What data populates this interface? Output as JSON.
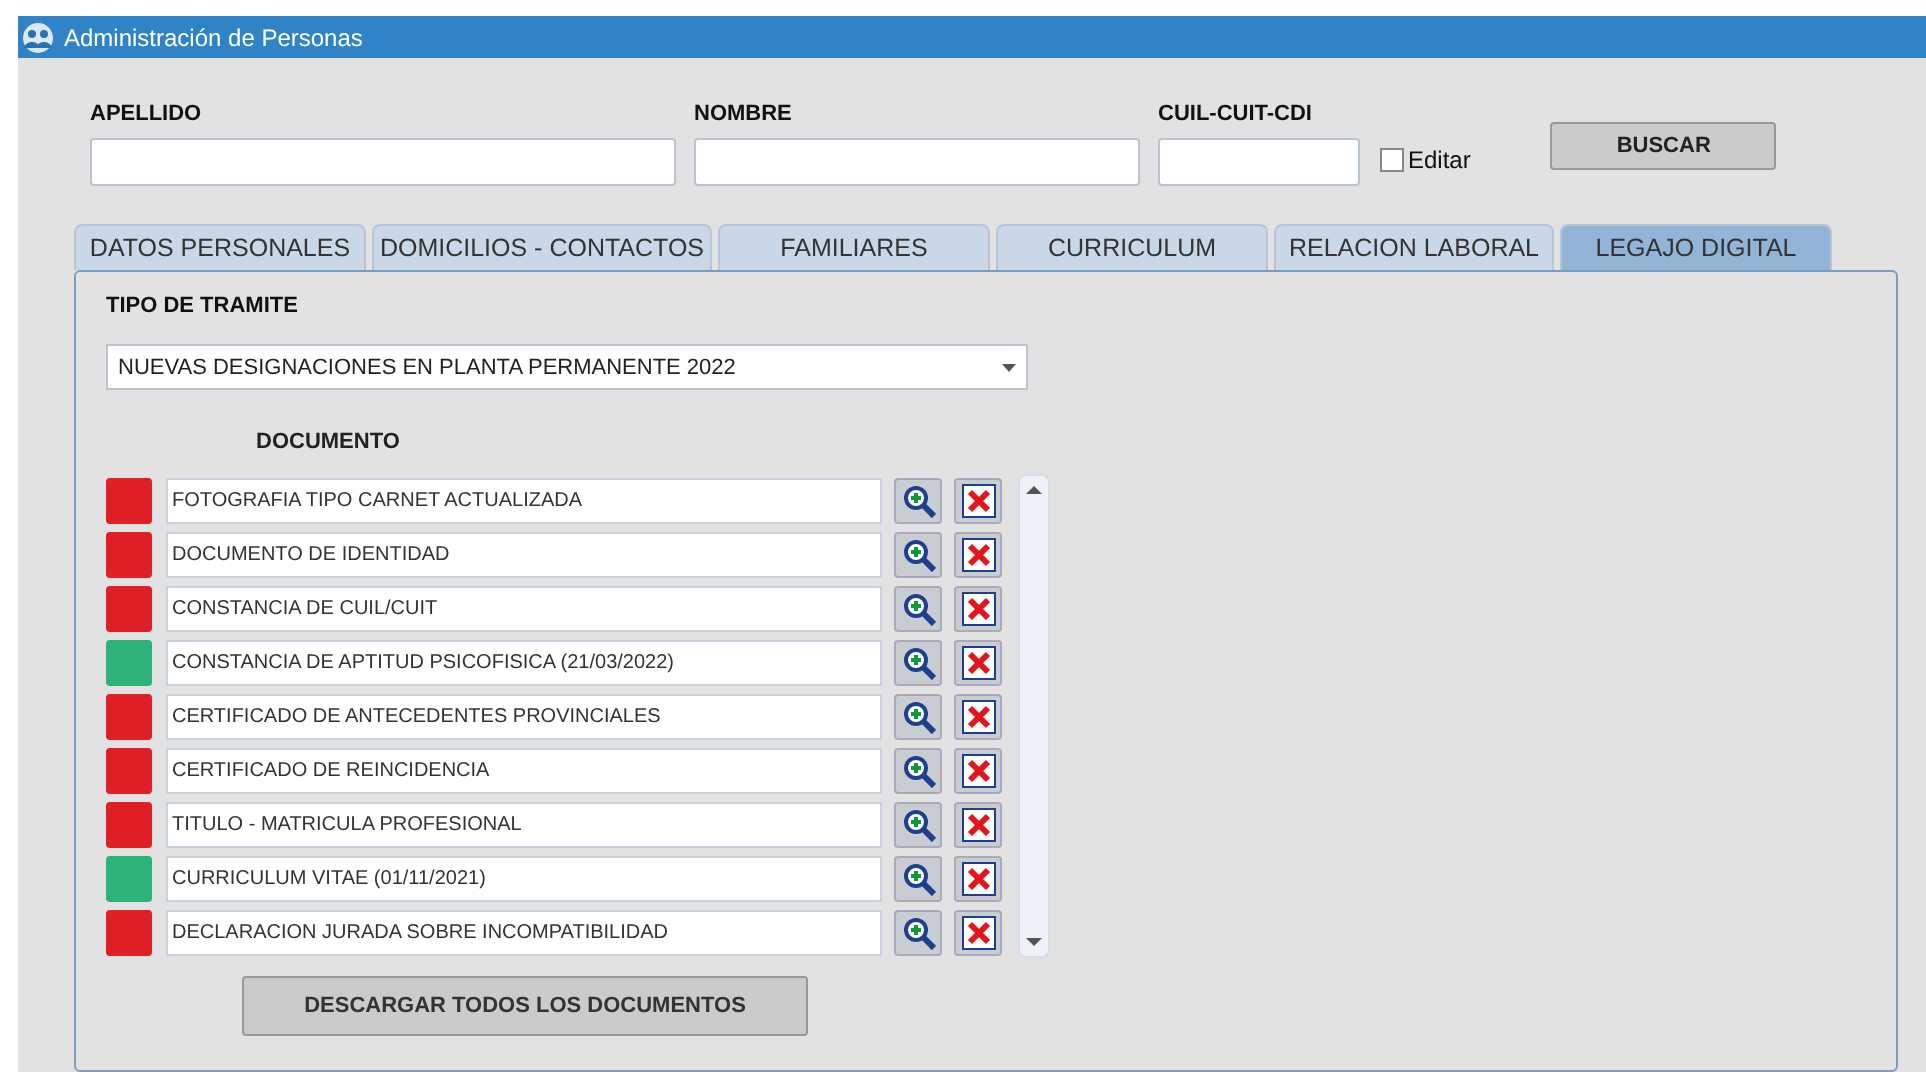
{
  "window": {
    "title": "Administración de Personas"
  },
  "search": {
    "fields": [
      {
        "label": "APELLIDO"
      },
      {
        "label": "NOMBRE"
      },
      {
        "label": "CUIL-CUIT-CDI"
      }
    ],
    "edit_checkbox": {
      "label": "Editar",
      "checked": false
    },
    "button": "BUSCAR"
  },
  "tabs": [
    {
      "label": "DATOS PERSONALES",
      "selected": false
    },
    {
      "label": "DOMICILIOS - CONTACTOS",
      "selected": false
    },
    {
      "label": "FAMILIARES",
      "selected": false
    },
    {
      "label": "CURRICULUM",
      "selected": false
    },
    {
      "label": "RELACION LABORAL",
      "selected": false
    },
    {
      "label": "LEGAJO DIGITAL",
      "selected": true
    }
  ],
  "tramite": {
    "label": "TIPO DE TRAMITE",
    "value": "NUEVAS DESIGNACIONES EN PLANTA PERMANENTE 2022"
  },
  "documents_header": "DOCUMENTO",
  "documents": [
    {
      "name": "FOTOGRAFIA TIPO CARNET ACTUALIZADA",
      "color": "#e01e26"
    },
    {
      "name": "DOCUMENTO DE IDENTIDAD",
      "color": "#e01e26"
    },
    {
      "name": "CONSTANCIA DE CUIL/CUIT",
      "color": "#e01e26"
    },
    {
      "name": "CONSTANCIA DE APTITUD PSICOFISICA (21/03/2022)",
      "color": "#2db37a"
    },
    {
      "name": "CERTIFICADO DE ANTECEDENTES PROVINCIALES",
      "color": "#e01e26"
    },
    {
      "name": "CERTIFICADO DE REINCIDENCIA",
      "color": "#e01e26"
    },
    {
      "name": "TITULO - MATRICULA PROFESIONAL",
      "color": "#e01e26"
    },
    {
      "name": "CURRICULUM VITAE (01/11/2021)",
      "color": "#2db37a"
    },
    {
      "name": "DECLARACION JURADA SOBRE INCOMPATIBILIDAD",
      "color": "#e01e26"
    }
  ],
  "download_button": "DESCARGAR TODOS LOS DOCUMENTOS"
}
